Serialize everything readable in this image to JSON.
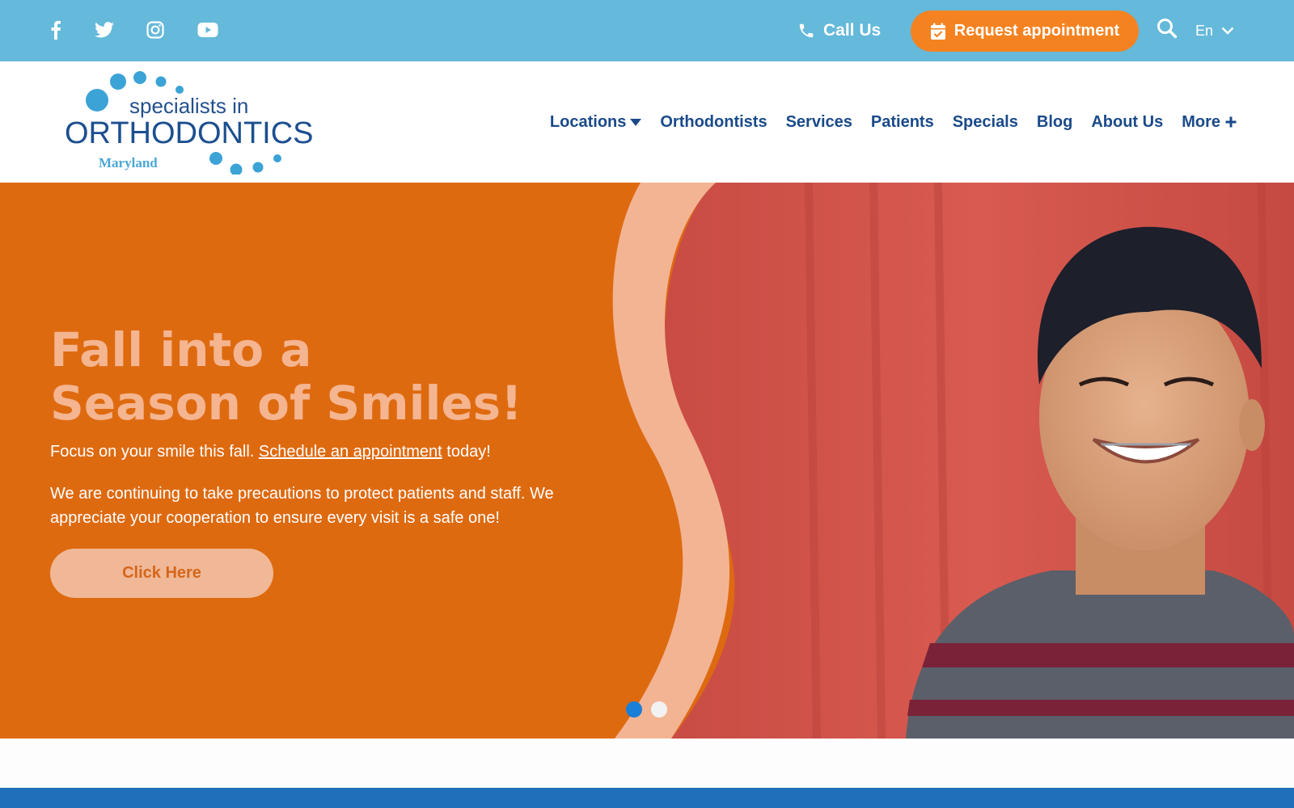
{
  "topbar": {
    "social": [
      {
        "name": "facebook-icon"
      },
      {
        "name": "twitter-icon"
      },
      {
        "name": "instagram-icon"
      },
      {
        "name": "youtube-icon"
      }
    ],
    "call_label": "Call Us",
    "request_label": "Request appointment",
    "language": "En"
  },
  "logo": {
    "line1": "specialists in",
    "line2": "ORTHODONTICS",
    "line3": "Maryland"
  },
  "nav": {
    "items": [
      {
        "label": "Locations"
      },
      {
        "label": "Orthodontists"
      },
      {
        "label": "Services"
      },
      {
        "label": "Patients"
      },
      {
        "label": "Specials"
      },
      {
        "label": "Blog"
      },
      {
        "label": "About Us"
      },
      {
        "label": "More"
      }
    ]
  },
  "hero": {
    "headline_line1": "Fall into a",
    "headline_line2": "Season of Smiles!",
    "promo_before": "Focus on your smile this fall. ",
    "promo_link": "Schedule an appointment",
    "promo_after": " today!",
    "notice": "We are continuing to take precautions to protect patients and staff. We appreciate your cooperation to ensure every visit is a safe one!",
    "cta_label": "Click Here",
    "slides_total": 2,
    "active_slide": 1
  },
  "colors": {
    "topbar": "#65b9da",
    "accent": "#f58220",
    "hero_orange": "#de6a10",
    "headline": "#f4b590",
    "nav_text": "#1a4a8a",
    "dot_active": "#1a7fd6",
    "band": "#1f6fba"
  }
}
